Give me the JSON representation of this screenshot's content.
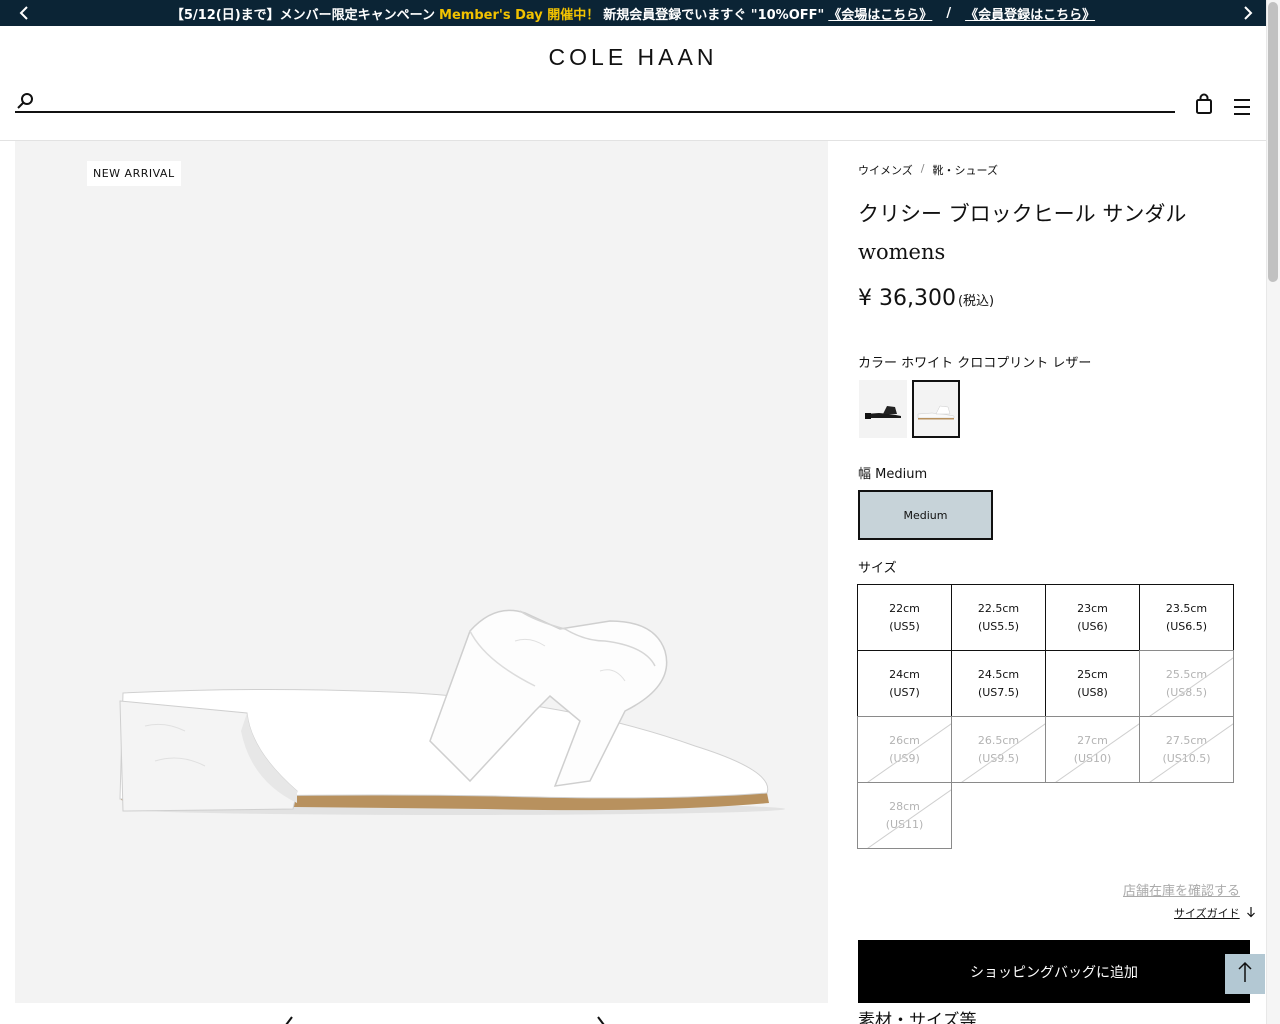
{
  "announcement": {
    "segment1": "【5/12(日)まで】メンバー限定キャンペーン",
    "highlight": "Member's Day 開催中！",
    "segment2": "新規会員登録でいますぐ \"10%OFF\"",
    "link1": "《会場はこちら》",
    "separator": "/",
    "link2": "《会員登録はこちら》"
  },
  "header": {
    "logo": "COLE HAAN"
  },
  "image_panel": {
    "badge": "NEW ARRIVAL"
  },
  "breadcrumb": {
    "items": [
      "ウイメンズ",
      "靴・シューズ"
    ],
    "separator": "/"
  },
  "product": {
    "title_line1": "クリシー ブロックヒール サンダル",
    "title_line2": "womens",
    "price": "¥ 36,300",
    "tax_note": "(税込)",
    "color_label": "カラー ホワイト クロコプリント レザー",
    "width_label": "幅 Medium",
    "width_option": "Medium",
    "size_label": "サイズ"
  },
  "sizes": [
    {
      "cm": "22cm",
      "us": "(US5)",
      "available": true
    },
    {
      "cm": "22.5cm",
      "us": "(US5.5)",
      "available": true
    },
    {
      "cm": "23cm",
      "us": "(US6)",
      "available": true
    },
    {
      "cm": "23.5cm",
      "us": "(US6.5)",
      "available": true
    },
    {
      "cm": "24cm",
      "us": "(US7)",
      "available": true
    },
    {
      "cm": "24.5cm",
      "us": "(US7.5)",
      "available": true
    },
    {
      "cm": "25cm",
      "us": "(US8)",
      "available": true
    },
    {
      "cm": "25.5cm",
      "us": "(US8.5)",
      "available": false
    },
    {
      "cm": "26cm",
      "us": "(US9)",
      "available": false
    },
    {
      "cm": "26.5cm",
      "us": "(US9.5)",
      "available": false
    },
    {
      "cm": "27cm",
      "us": "(US10)",
      "available": false
    },
    {
      "cm": "27.5cm",
      "us": "(US10.5)",
      "available": false
    },
    {
      "cm": "28cm",
      "us": "(US11)",
      "available": false
    }
  ],
  "actions": {
    "store_stock": "店舗在庫を確認する",
    "size_guide": "サイズガイド",
    "add_to_bag": "ショッピングバッグに追加",
    "material_heading": "素材・サイズ等"
  },
  "colors": {
    "announce_bg": "#0b2435",
    "highlight": "#f2c200",
    "width_selected_bg": "#c7d3d9",
    "to_top_bg": "#b3c8d3"
  },
  "icons": [
    "chevron-left-icon",
    "chevron-right-icon",
    "search-icon",
    "shopping-bag-icon",
    "hamburger-menu-icon",
    "arrow-up-icon",
    "arrow-down-icon"
  ]
}
